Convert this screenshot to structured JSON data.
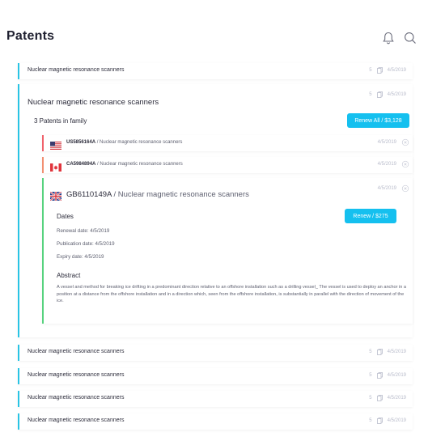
{
  "header": {
    "title": "Patents",
    "notification_icon": "bell-icon",
    "search_icon": "search-icon"
  },
  "colors": {
    "accent": "#29c4e4",
    "button": "#15c0ef",
    "us_border": "#f0626b",
    "ca_border": "#f28f72",
    "gb_border": "#57d27e"
  },
  "rows_top": [
    {
      "title": "Nuclear magnetic resonance scanners",
      "count": "5",
      "date": "4/5/2019"
    }
  ],
  "expanded": {
    "title": "Nuclear magnetic resonance scanners",
    "count": "5",
    "date": "4/5/2019",
    "family_label": "3 Patents in family",
    "renew_all_label": "Renew All / $3,128",
    "patents": [
      {
        "number": "US5856164A",
        "separator": " / ",
        "title": "Nuclear magnetic resonance scanners",
        "date": "4/5/2019",
        "flag": "us-flag-icon"
      },
      {
        "number": "CA5984894A",
        "separator": " / ",
        "title": "Nuclear magnetic resonance scanners",
        "date": "4/5/2019",
        "flag": "canada-flag-icon"
      }
    ],
    "detail": {
      "number": "GB6110149A",
      "separator": " / ",
      "title": "Nuclear magnetic resonance scanners",
      "date": "4/5/2019",
      "flag": "uk-flag-icon",
      "renew_label": "Renew / $275",
      "dates_heading": "Dates",
      "renewal": "Renewal date: 4/5/2019",
      "publication": "Publication date: 4/5/2019",
      "expiry": "Expiry date: 4/5/2019",
      "abstract_heading": "Abstract",
      "abstract": "A vessel and method for breaking ice drifting in a predominant direction relative to an offshore installation such as a drilling vessel_ The vessel is used to deploy an anchor in a position at a distance from the offshore installation and in a direction which, seen from the offshore installation, is substantially in parallel with the direction of movement of the ice."
    }
  },
  "rows_bottom": [
    {
      "title": "Nuclear magnetic resonance scanners",
      "count": "5",
      "date": "4/5/2019"
    },
    {
      "title": "Nuclear magnetic resonance scanners",
      "count": "5",
      "date": "4/5/2019"
    },
    {
      "title": "Nuclear magnetic resonance scanners",
      "count": "5",
      "date": "4/5/2019"
    },
    {
      "title": "Nuclear magnetic resonance scanners",
      "count": "5",
      "date": "4/5/2019"
    }
  ]
}
